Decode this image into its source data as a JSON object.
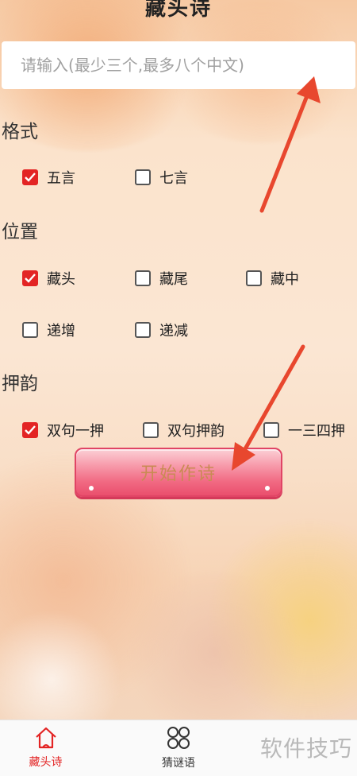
{
  "header": {
    "title": "藏头诗"
  },
  "input": {
    "placeholder": "请输入(最少三个,最多八个中文)"
  },
  "sections": {
    "format": {
      "label": "格式",
      "options": [
        {
          "label": "五言",
          "checked": true
        },
        {
          "label": "七言",
          "checked": false
        }
      ]
    },
    "position": {
      "label": "位置",
      "options": [
        {
          "label": "藏头",
          "checked": true
        },
        {
          "label": "藏尾",
          "checked": false
        },
        {
          "label": "藏中",
          "checked": false
        },
        {
          "label": "递增",
          "checked": false
        },
        {
          "label": "递减",
          "checked": false
        }
      ]
    },
    "rhyme": {
      "label": "押韵",
      "options": [
        {
          "label": "双句一押",
          "checked": true
        },
        {
          "label": "双句押韵",
          "checked": false
        },
        {
          "label": "一三四押",
          "checked": false
        }
      ]
    }
  },
  "actions": {
    "start_label": "开始作诗"
  },
  "tabs": [
    {
      "label": "藏头诗",
      "icon": "home-icon",
      "active": true
    },
    {
      "label": "猜谜语",
      "icon": "clover-icon",
      "active": false
    }
  ],
  "watermark": "软件技巧",
  "colors": {
    "accent": "#e32424",
    "arrow": "#e8472e",
    "button": "#f16a83"
  }
}
